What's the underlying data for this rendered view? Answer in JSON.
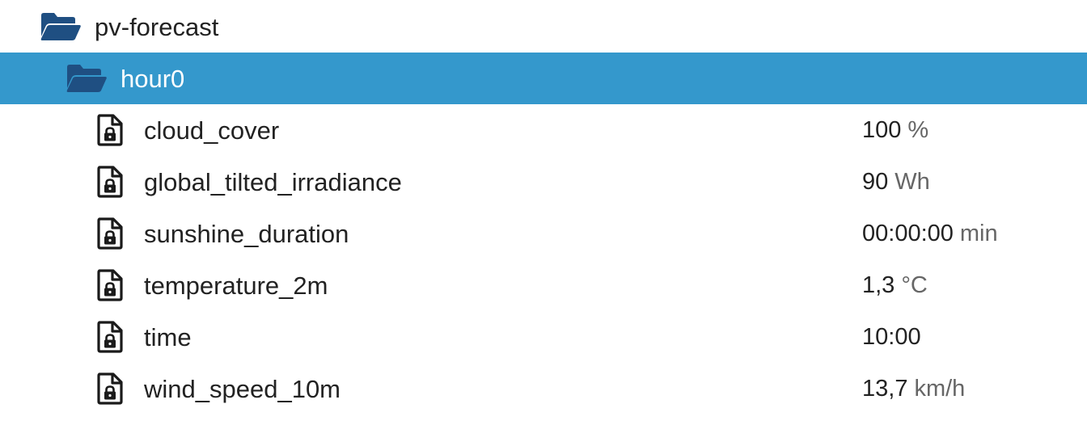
{
  "tree": {
    "root_folder": {
      "label": "pv-forecast",
      "icon": "folder-open-icon"
    },
    "selected_folder": {
      "label": "hour0",
      "icon": "folder-open-icon"
    },
    "states": [
      {
        "name": "cloud_cover",
        "value": "100",
        "unit": "%",
        "icon": "locked-file-icon"
      },
      {
        "name": "global_tilted_irradiance",
        "value": "90",
        "unit": "Wh",
        "icon": "locked-file-icon"
      },
      {
        "name": "sunshine_duration",
        "value": "00:00:00",
        "unit": "min",
        "icon": "locked-file-icon"
      },
      {
        "name": "temperature_2m",
        "value": "1,3",
        "unit": "°C",
        "icon": "locked-file-icon"
      },
      {
        "name": "time",
        "value": "10:00",
        "unit": "",
        "icon": "locked-file-icon"
      },
      {
        "name": "wind_speed_10m",
        "value": "13,7",
        "unit": "km/h",
        "icon": "locked-file-icon"
      }
    ]
  },
  "colors": {
    "selected_row_bg": "#3498cc",
    "folder_icon": "#1f4f82",
    "unit_text": "#666666"
  }
}
